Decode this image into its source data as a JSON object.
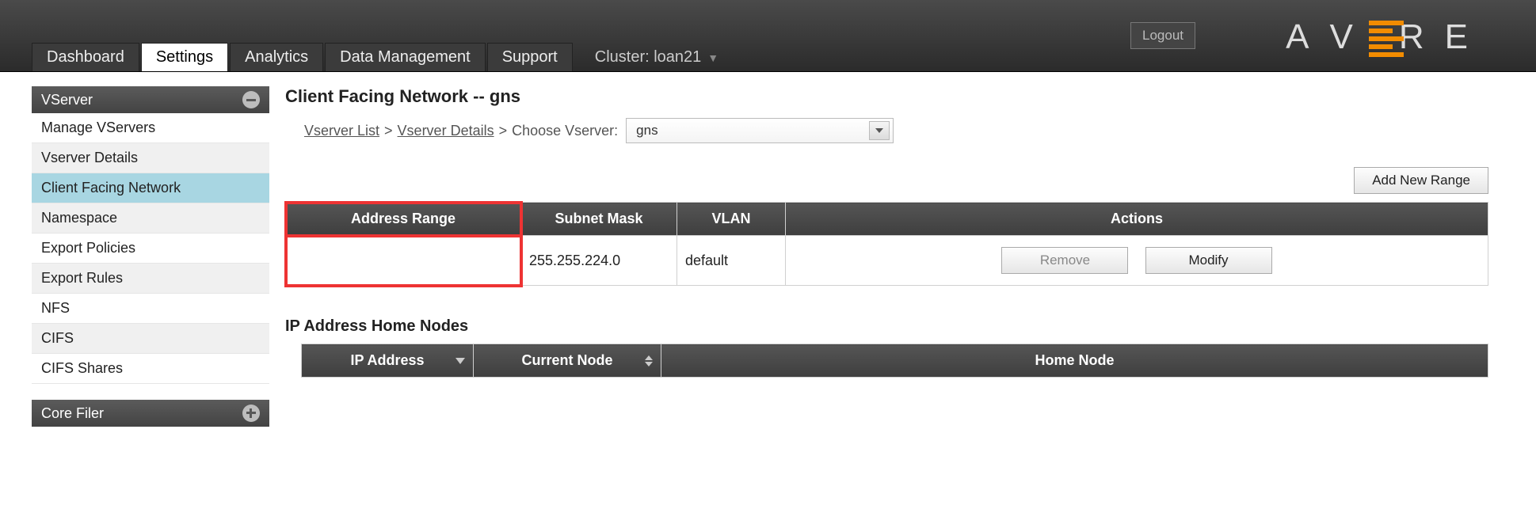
{
  "header": {
    "logout": "Logout",
    "brand_letters": [
      "A",
      "V",
      "R",
      "E"
    ],
    "cluster_prefix": "Cluster:",
    "cluster_name": "loan21"
  },
  "tabs": {
    "items": [
      "Dashboard",
      "Settings",
      "Analytics",
      "Data Management",
      "Support"
    ],
    "active_index": 1
  },
  "sidebar": {
    "section1": {
      "title": "VServer",
      "items": [
        "Manage VServers",
        "Vserver Details",
        "Client Facing Network",
        "Namespace",
        "Export Policies",
        "Export Rules",
        "NFS",
        "CIFS",
        "CIFS Shares"
      ],
      "active_index": 2
    },
    "section2": {
      "title": "Core Filer"
    }
  },
  "page": {
    "title": "Client Facing Network -- gns",
    "breadcrumb": {
      "link1": "Vserver List",
      "link2": "Vserver Details",
      "choose": "Choose Vserver:",
      "selected": "gns"
    },
    "add_range": "Add New Range",
    "range_table": {
      "headers": [
        "Address Range",
        "Subnet Mask",
        "VLAN",
        "Actions"
      ],
      "row": {
        "address_range": "",
        "subnet_mask": "255.255.224.0",
        "vlan": "default",
        "remove": "Remove",
        "modify": "Modify"
      }
    },
    "nodes_title": "IP Address Home Nodes",
    "nodes_table": {
      "headers": [
        "IP Address",
        "Current Node",
        "Home Node"
      ]
    }
  }
}
